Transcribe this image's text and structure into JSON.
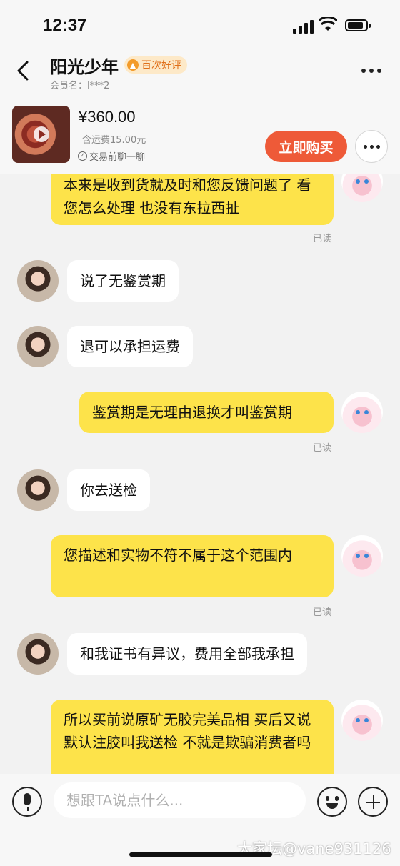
{
  "status": {
    "time": "12:37"
  },
  "header": {
    "title": "阳光少年",
    "badge": "百次好评",
    "member": "会员名：l***2"
  },
  "product": {
    "price": "¥360.00",
    "shipping": "含运费15.00元",
    "chat_first": "交易前聊一聊",
    "buy_label": "立即购买"
  },
  "messages": [
    {
      "from": "me",
      "text": "本来是收到货就及时和您反馈问题了 看您怎么处理 也没有东拉西扯",
      "status": "已读"
    },
    {
      "from": "them",
      "text": "说了无鉴赏期"
    },
    {
      "from": "them",
      "text": "退可以承担运费"
    },
    {
      "from": "me",
      "text": "鉴赏期是无理由退换才叫鉴赏期",
      "status": "已读"
    },
    {
      "from": "them",
      "text": "你去送检"
    },
    {
      "from": "me",
      "text": "您描述和实物不符不属于这个范围内",
      "status": "已读"
    },
    {
      "from": "them",
      "text": "和我证书有异议，费用全部我承担"
    },
    {
      "from": "me",
      "text": "所以买前说原矿无胶完美品相 买后又说默认注胶叫我送检 不就是欺骗消费者吗"
    }
  ],
  "input": {
    "placeholder": "想跟TA说点什么..."
  },
  "watermark": "大家坛@vane931126"
}
